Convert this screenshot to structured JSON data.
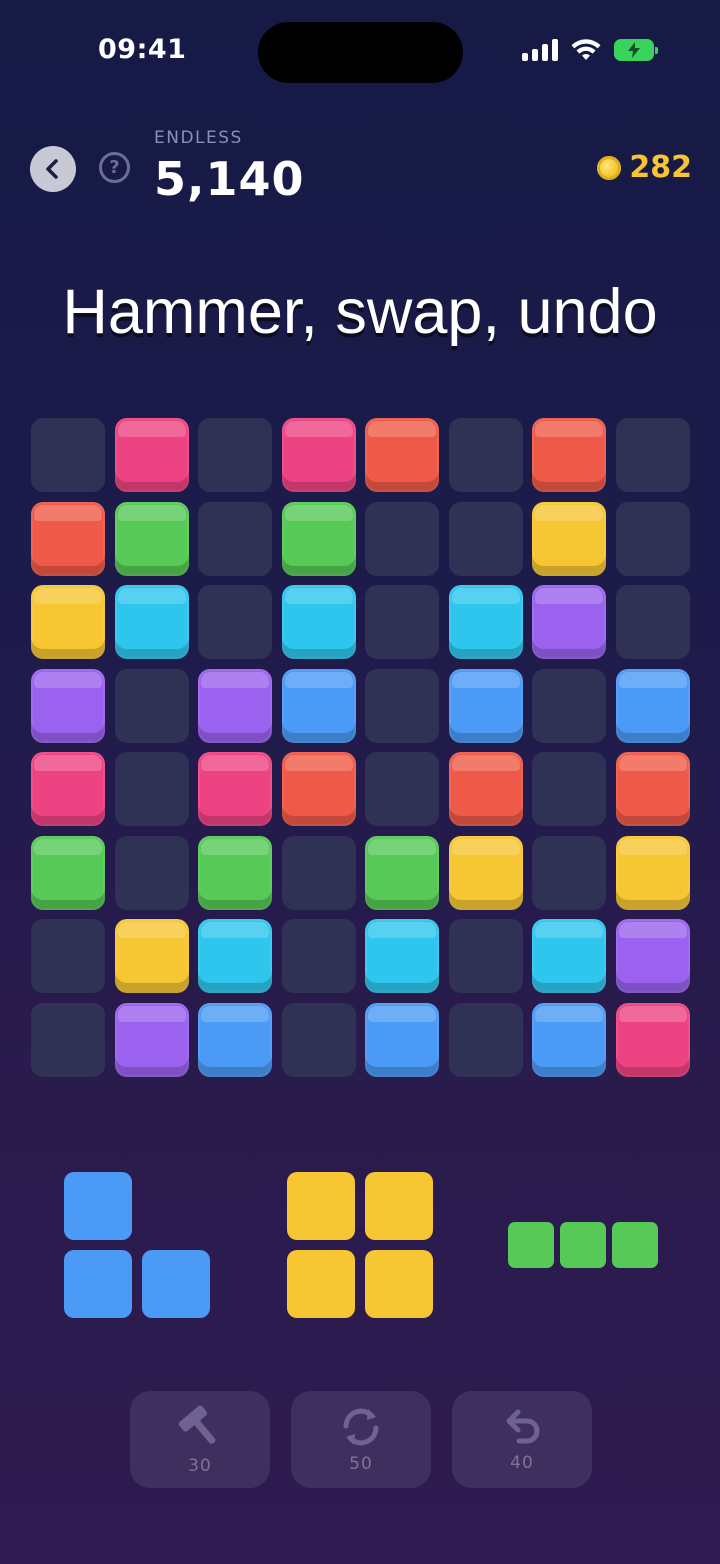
{
  "status_bar": {
    "time": "09:41"
  },
  "header": {
    "mode": "ENDLESS",
    "score": "5,140",
    "coins": "282",
    "back_icon": "chevron-left-icon",
    "help_icon": "question-icon"
  },
  "headline": "Hammer, swap, undo",
  "colors": {
    "empty": "#2f3254",
    "pink": "#ee4382",
    "red": "#ef5a48",
    "green": "#56c956",
    "yellow": "#f6c633",
    "cyan": "#2fc6ee",
    "purple": "#9a62ee",
    "blue": "#4a9af6"
  },
  "board": [
    [
      null,
      "pink",
      null,
      "pink",
      "red",
      null,
      "red",
      null
    ],
    [
      "red",
      "green",
      null,
      "green",
      null,
      null,
      "yellow",
      null
    ],
    [
      "yellow",
      "cyan",
      null,
      "cyan",
      null,
      "cyan",
      "purple",
      null
    ],
    [
      "purple",
      null,
      "purple",
      "blue",
      null,
      "blue",
      null,
      "blue"
    ],
    [
      "pink",
      null,
      "pink",
      "red",
      null,
      "red",
      null,
      "red"
    ],
    [
      "green",
      null,
      "green",
      null,
      "green",
      "yellow",
      null,
      "yellow"
    ],
    [
      null,
      "yellow",
      "cyan",
      null,
      "cyan",
      null,
      "cyan",
      "purple"
    ],
    [
      null,
      "purple",
      "blue",
      null,
      "blue",
      null,
      "blue",
      "pink"
    ]
  ],
  "tray": [
    {
      "color": "blue",
      "cells": [
        [
          0,
          0
        ],
        [
          1,
          0
        ],
        [
          1,
          1
        ]
      ]
    },
    {
      "color": "yellow",
      "cells": [
        [
          0,
          0
        ],
        [
          0,
          1
        ],
        [
          1,
          0
        ],
        [
          1,
          1
        ]
      ]
    },
    {
      "color": "green",
      "cells": [
        [
          0,
          0
        ],
        [
          0,
          1
        ],
        [
          0,
          2
        ]
      ]
    }
  ],
  "powerups": [
    {
      "icon": "hammer-icon",
      "cost": "30"
    },
    {
      "icon": "swap-icon",
      "cost": "50"
    },
    {
      "icon": "undo-icon",
      "cost": "40"
    }
  ]
}
